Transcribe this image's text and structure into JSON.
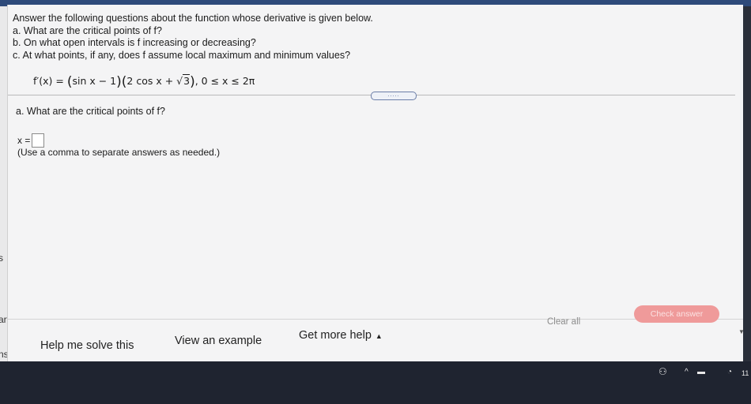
{
  "question": {
    "intro": "Answer the following questions about the function whose derivative is given below.",
    "parts": [
      "a. What are the critical points of f?",
      "b. On what open intervals is f increasing or decreasing?",
      "c. At what points, if any, does f assume local maximum and minimum values?"
    ],
    "formula": {
      "lhs": "f′(x) = ",
      "factor1": "sin x − 1",
      "factor2_before": "2 cos x + ",
      "sqrt_arg": "3",
      "domain": ", 0 ≤ x ≤ 2π"
    }
  },
  "expand_button": ".....",
  "part_a": {
    "prompt": "a. What are the critical points of f?",
    "input_label": "x =",
    "input_value": "",
    "hint": "(Use a comma to separate answers as needed.)"
  },
  "left_panel": {
    "labels": [
      "s",
      "ary",
      "ns"
    ]
  },
  "footer": {
    "help_me_solve": "Help me solve this",
    "view_example": "View an example",
    "get_more_help": "Get more help",
    "clear_all": "Clear all",
    "check_answer": "Check answer"
  },
  "taskbar": {
    "clock_partial": "11"
  }
}
